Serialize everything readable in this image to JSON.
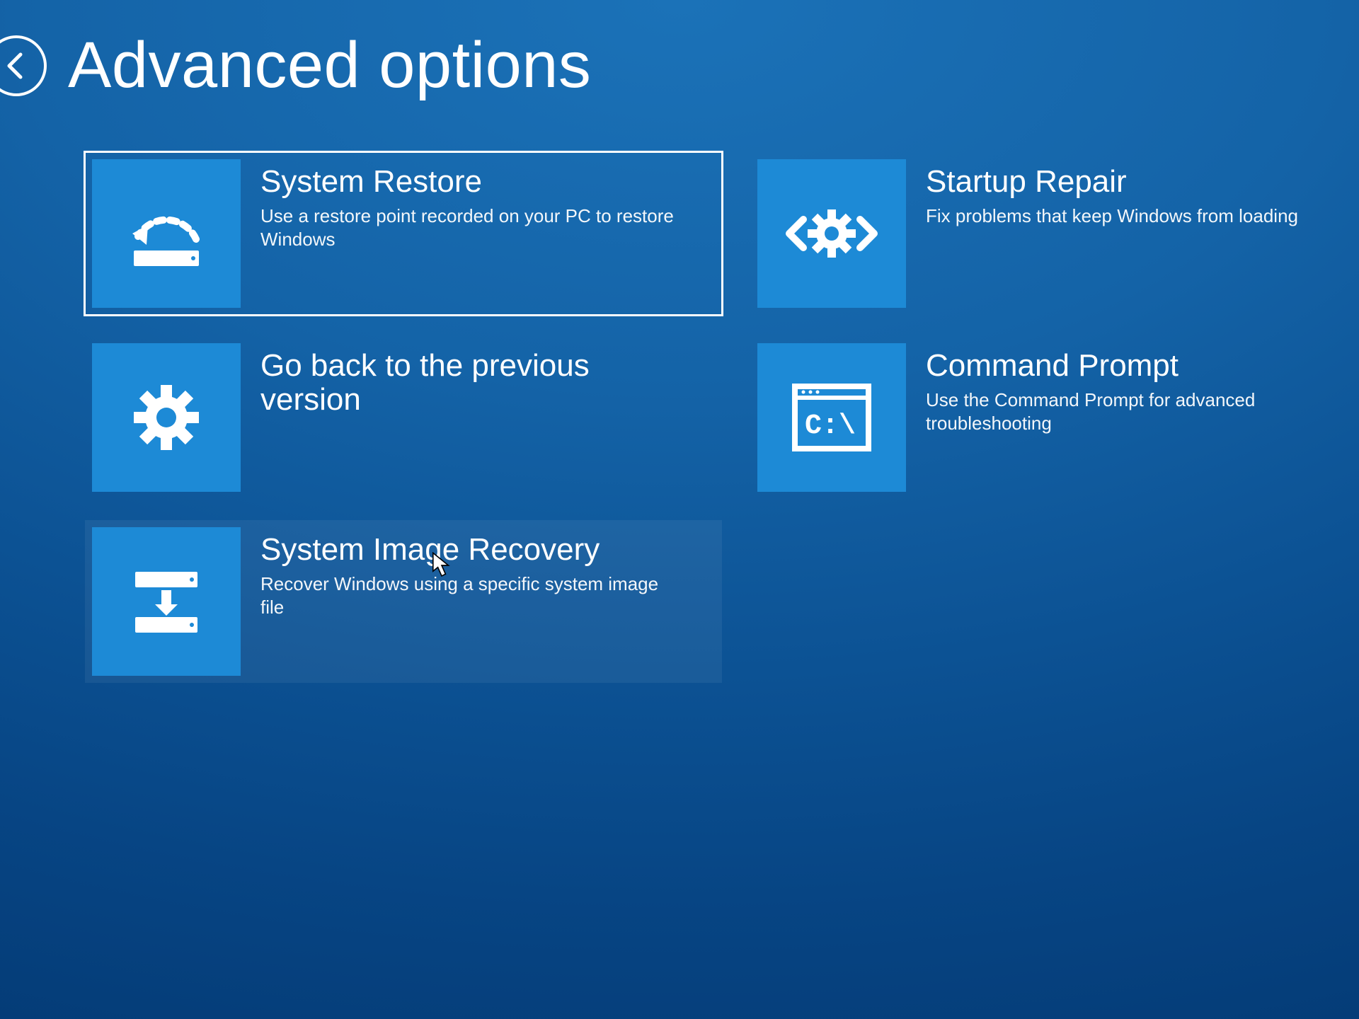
{
  "page": {
    "title": "Advanced options"
  },
  "tiles": {
    "system_restore": {
      "label": "System Restore",
      "desc": "Use a restore point recorded on your PC to restore Windows"
    },
    "startup_repair": {
      "label": "Startup Repair",
      "desc": "Fix problems that keep Windows from loading"
    },
    "go_back": {
      "label": "Go back to the previous version",
      "desc": ""
    },
    "command_prompt": {
      "label": "Command Prompt",
      "desc": "Use the Command Prompt for advanced troubleshooting"
    },
    "system_image_recovery": {
      "label": "System Image Recovery",
      "desc": "Recover Windows using a specific system image file"
    }
  }
}
